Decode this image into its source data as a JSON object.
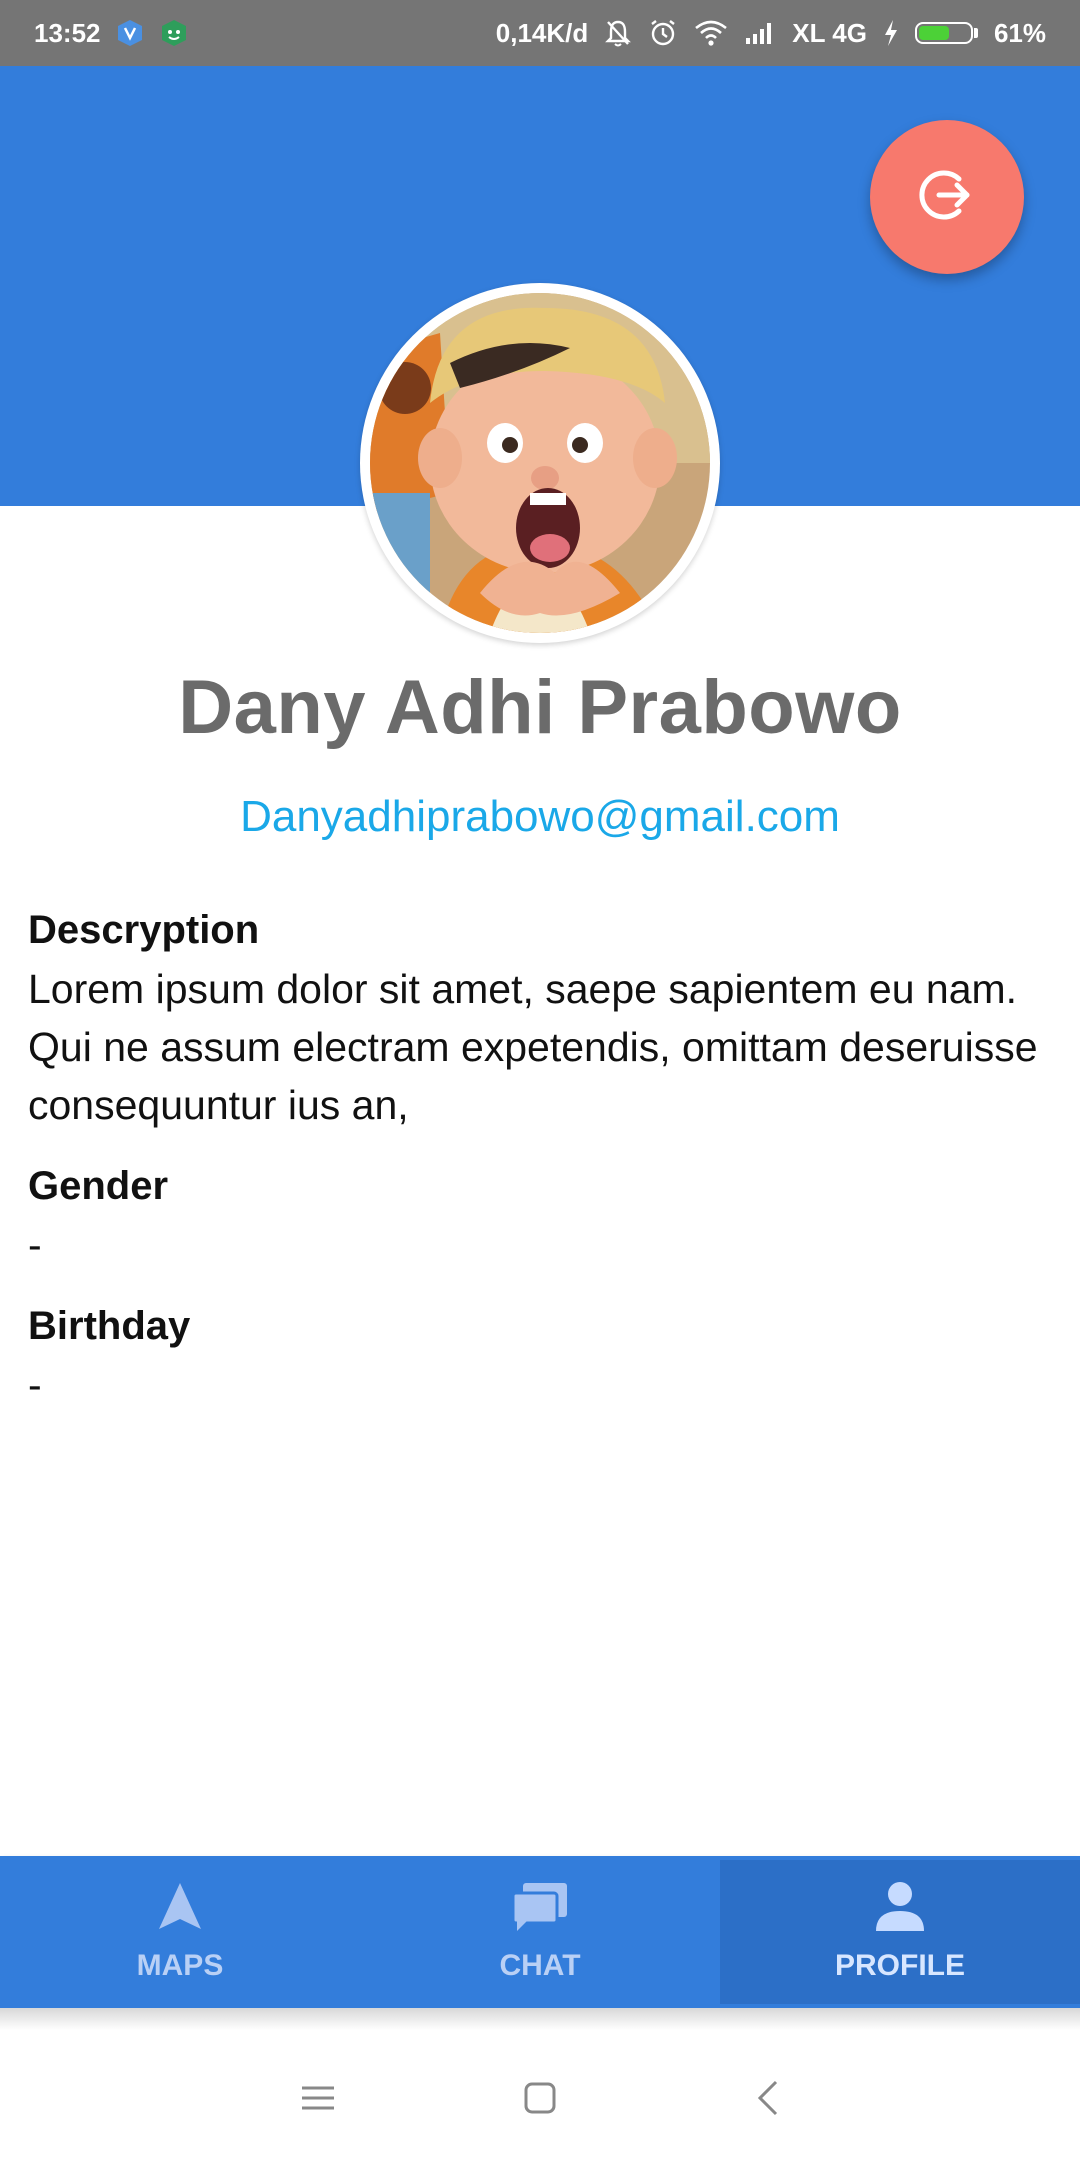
{
  "status_bar": {
    "time": "13:52",
    "network_speed": "0,14K/d",
    "carrier": "XL 4G",
    "battery_text": "61%",
    "battery_level": 0.61,
    "icons": [
      "shield-app-icon",
      "android-app-icon",
      "mute-bell-icon",
      "alarm-icon",
      "wifi-icon",
      "signal-icon",
      "charging-icon",
      "battery-icon"
    ]
  },
  "header": {
    "background_color": "#337ddb",
    "logout_icon": "logout-icon",
    "logout_color": "#f7796d"
  },
  "profile": {
    "name": "Dany Adhi Prabowo",
    "email": "Danyadhiprabowo@gmail.com"
  },
  "info": {
    "description_label": "Descryption",
    "description_value": "Lorem ipsum dolor sit amet, saepe sapientem eu nam. Qui ne assum electram expetendis, omittam deseruisse consequuntur ius an,",
    "gender_label": "Gender",
    "gender_value": "-",
    "birthday_label": "Birthday",
    "birthday_value": "-"
  },
  "bottom_nav": {
    "items": [
      {
        "label": "MAPS",
        "icon": "navigation-arrow-icon",
        "active": false
      },
      {
        "label": "CHAT",
        "icon": "chat-icon",
        "active": false
      },
      {
        "label": "PROFILE",
        "icon": "person-icon",
        "active": true
      }
    ]
  },
  "system_nav": {
    "icons": [
      "menu-icon",
      "home-icon",
      "back-icon"
    ]
  }
}
